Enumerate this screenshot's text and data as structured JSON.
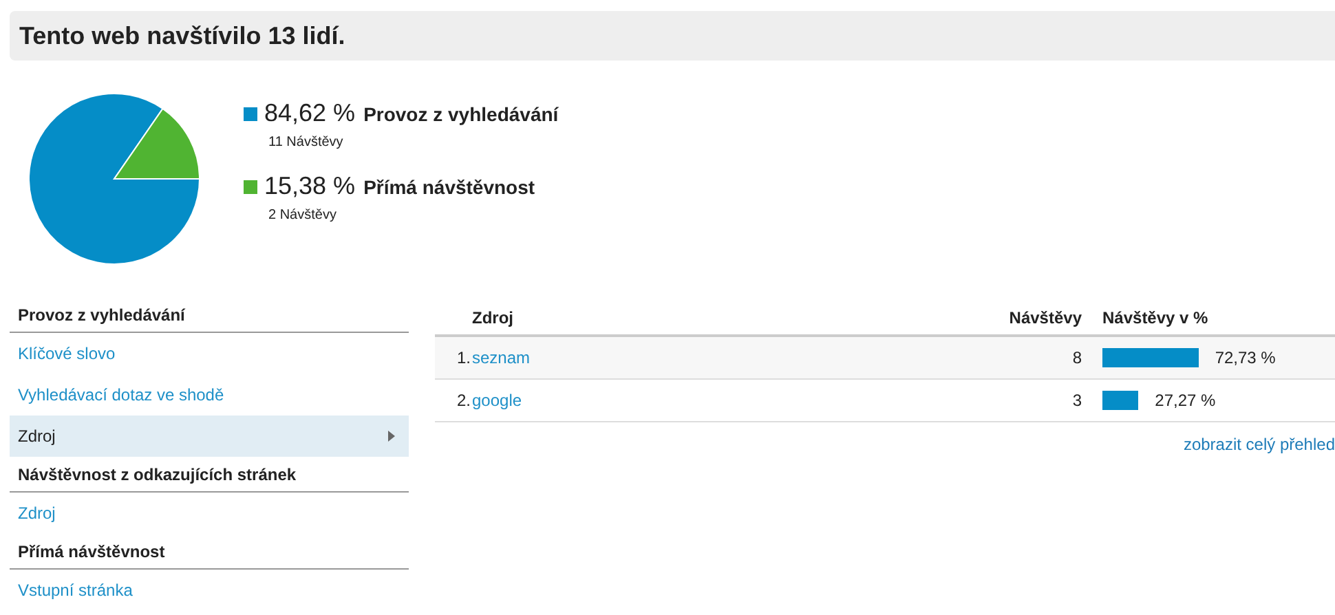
{
  "title": "Tento web navštívilo 13 lidí.",
  "pie": {
    "chart_data": {
      "type": "pie",
      "categories": [
        "Provoz z vyhledávání",
        "Přímá návštěvnost"
      ],
      "values": [
        84.62,
        15.38
      ]
    }
  },
  "legend": [
    {
      "percent": "84,62 %",
      "visits": "11 Návštěvy",
      "color": "#058dc7"
    },
    {
      "percent": "15,38 %",
      "visits": "2 Návštěvy",
      "color": "#50b432"
    }
  ],
  "sidebar": [
    {
      "heading": "Provoz z vyhledávání",
      "items": [
        {
          "label": "Klíčové slovo",
          "selected": false
        },
        {
          "label": "Vyhledávací dotaz ve shodě",
          "selected": false
        },
        {
          "label": "Zdroj",
          "selected": true
        }
      ]
    },
    {
      "heading": "Návštěvnost z odkazujících stránek",
      "items": [
        {
          "label": "Zdroj",
          "selected": false
        }
      ]
    },
    {
      "heading": "Přímá návštěvnost",
      "items": [
        {
          "label": "Vstupní stránka",
          "selected": false
        }
      ]
    }
  ],
  "table": {
    "columns": [
      "Zdroj",
      "Návštěvy",
      "Návštěvy v %"
    ],
    "rows": [
      {
        "rank": "1.",
        "source": "seznam",
        "visits": "8",
        "percent": "72,73 %"
      },
      {
        "rank": "2.",
        "source": "google",
        "visits": "3",
        "percent": "27,27 %"
      }
    ]
  },
  "full_report_link": "zobrazit celý přehled"
}
